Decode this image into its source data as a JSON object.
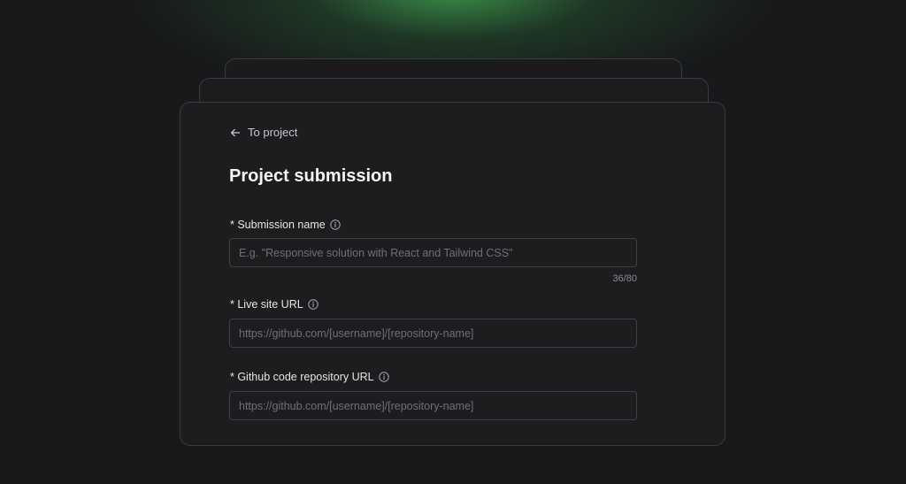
{
  "back_link": {
    "label": "To project",
    "icon": "arrow-left-icon"
  },
  "page_title": "Project submission",
  "fields": [
    {
      "label": "* Submission name",
      "placeholder": "E.g. \"Responsive solution with React and Tailwind CSS\"",
      "value": "",
      "counter": "36/80",
      "icon": "info-icon"
    },
    {
      "label": "* Live site URL",
      "placeholder": "https://github.com/[username]/[repository-name]",
      "value": "",
      "icon": "info-icon"
    },
    {
      "label": "* Github code repository URL",
      "placeholder": "https://github.com/[username]/[repository-name]",
      "value": "",
      "icon": "info-icon"
    }
  ],
  "colors": {
    "background": "#18191b",
    "card": "#1d1d20",
    "glow": "#3f9e4f",
    "border": "#3a3b3f"
  }
}
